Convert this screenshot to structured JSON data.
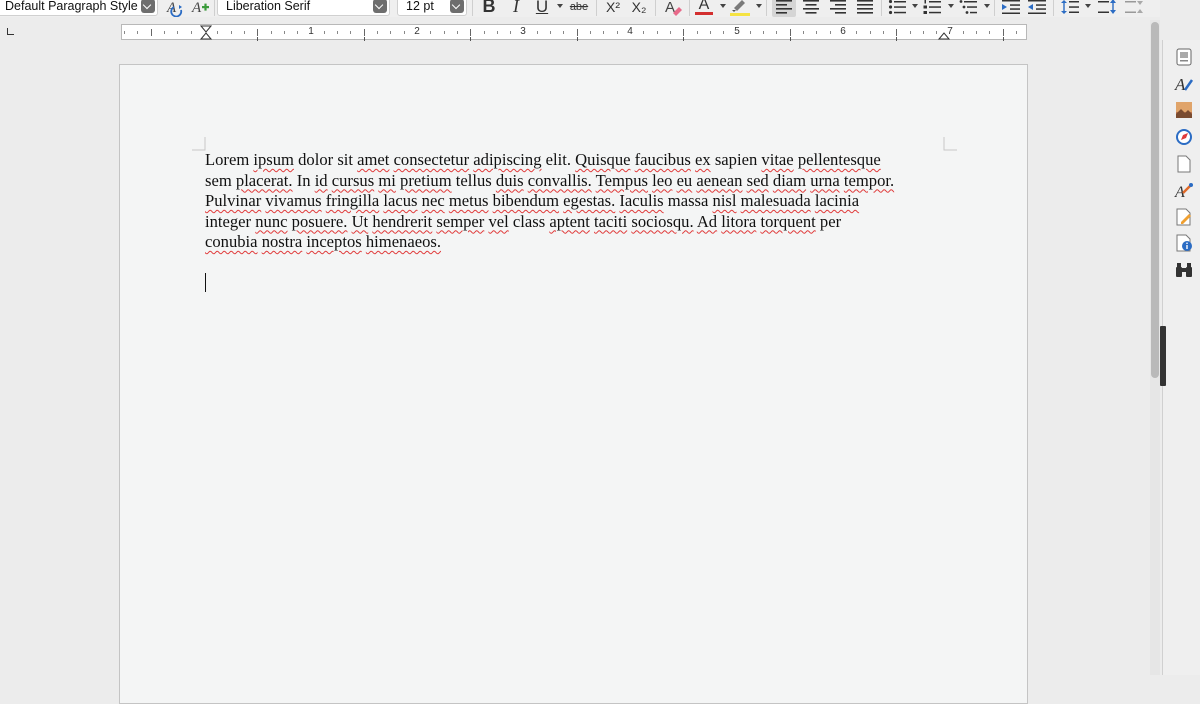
{
  "toolbar": {
    "paragraph_style": "Default Paragraph Style",
    "font_name": "Liberation Serif",
    "font_size": "12 pt",
    "bold_label": "B",
    "italic_label": "I",
    "underline_label": "U",
    "strikethrough_label": "abe",
    "superscript_label": "X²",
    "subscript_label": "X₂",
    "font_color_label": "A",
    "colors": {
      "font_color": "#d32f2f",
      "highlight_color": "#f5e342",
      "spellcheck": "#2e7d32",
      "squiggle": "#e03a3a"
    }
  },
  "ruler": {
    "numbers": [
      "1",
      "2",
      "3",
      "4",
      "5",
      "6",
      "7"
    ]
  },
  "document": {
    "lines": [
      "Lorem ipsum dolor sit amet consectetur adipiscing elit. Quisque faucibus ex sapien vitae pellentesque",
      "sem placerat. In id cursus mi pretium tellus duis convallis. Tempus leo eu aenean sed diam urna tempor.",
      "Pulvinar vivamus fringilla lacus nec metus bibendum egestas. Iaculis massa nisl malesuada lacinia",
      "integer nunc posuere. Ut hendrerit semper vel class aptent taciti sociosqu. Ad litora torquent per",
      "conubia nostra inceptos himenaeos."
    ]
  },
  "sidebar": {
    "icons": [
      "properties-icon",
      "styles-icon",
      "gallery-icon",
      "navigator-icon",
      "page-icon",
      "style-inspector-icon",
      "manage-changes-icon",
      "design-icon",
      "find-replace-icon"
    ]
  }
}
